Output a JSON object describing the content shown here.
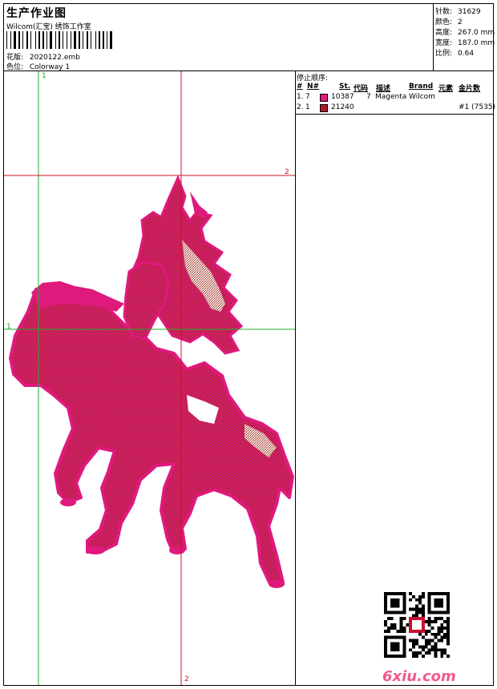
{
  "header": {
    "title": "生产作业图",
    "company": "Wilcom(汇宝) 绣饰工作室",
    "design_label": "花版:",
    "design_value": "2020122.emb",
    "colorway_label": "色位:",
    "colorway_value": "Colorway 1"
  },
  "stats": {
    "stitches_label": "针数:",
    "stitches_value": "31629",
    "colors_label": "颜色:",
    "colors_value": "2",
    "height_label": "高度:",
    "height_value": "267.0 mm",
    "width_label": "宽度:",
    "width_value": "187.0 mm",
    "scale_label": "比例:",
    "scale_value": "0.64"
  },
  "stop_sequence": {
    "title": "停止顺序:",
    "columns": [
      "#",
      "N#",
      "St.",
      "代码",
      "描述",
      "Brand",
      "元素",
      "金片数"
    ],
    "rows": [
      {
        "idx": "1.",
        "n": "7",
        "st": "10387",
        "code": "7",
        "desc": "Magenta",
        "brand": "Wilcom",
        "elem": "",
        "seq": "",
        "color": "#e0197d"
      },
      {
        "idx": "2.",
        "n": "1",
        "st": "21240",
        "code": "",
        "desc": "",
        "brand": "",
        "elem": "",
        "seq": "#1 (7535)",
        "color": "#b0182a"
      }
    ]
  },
  "crosshair_labels": {
    "top_green": "1",
    "left_green": "1",
    "right_red": "2",
    "bottom_red": "2"
  },
  "watermark": "6xiu.com",
  "colors": {
    "magenta": "#e0197d",
    "dark_red": "#9a2a1a",
    "guide_red": "#d01020",
    "guide_green": "#22b022"
  }
}
